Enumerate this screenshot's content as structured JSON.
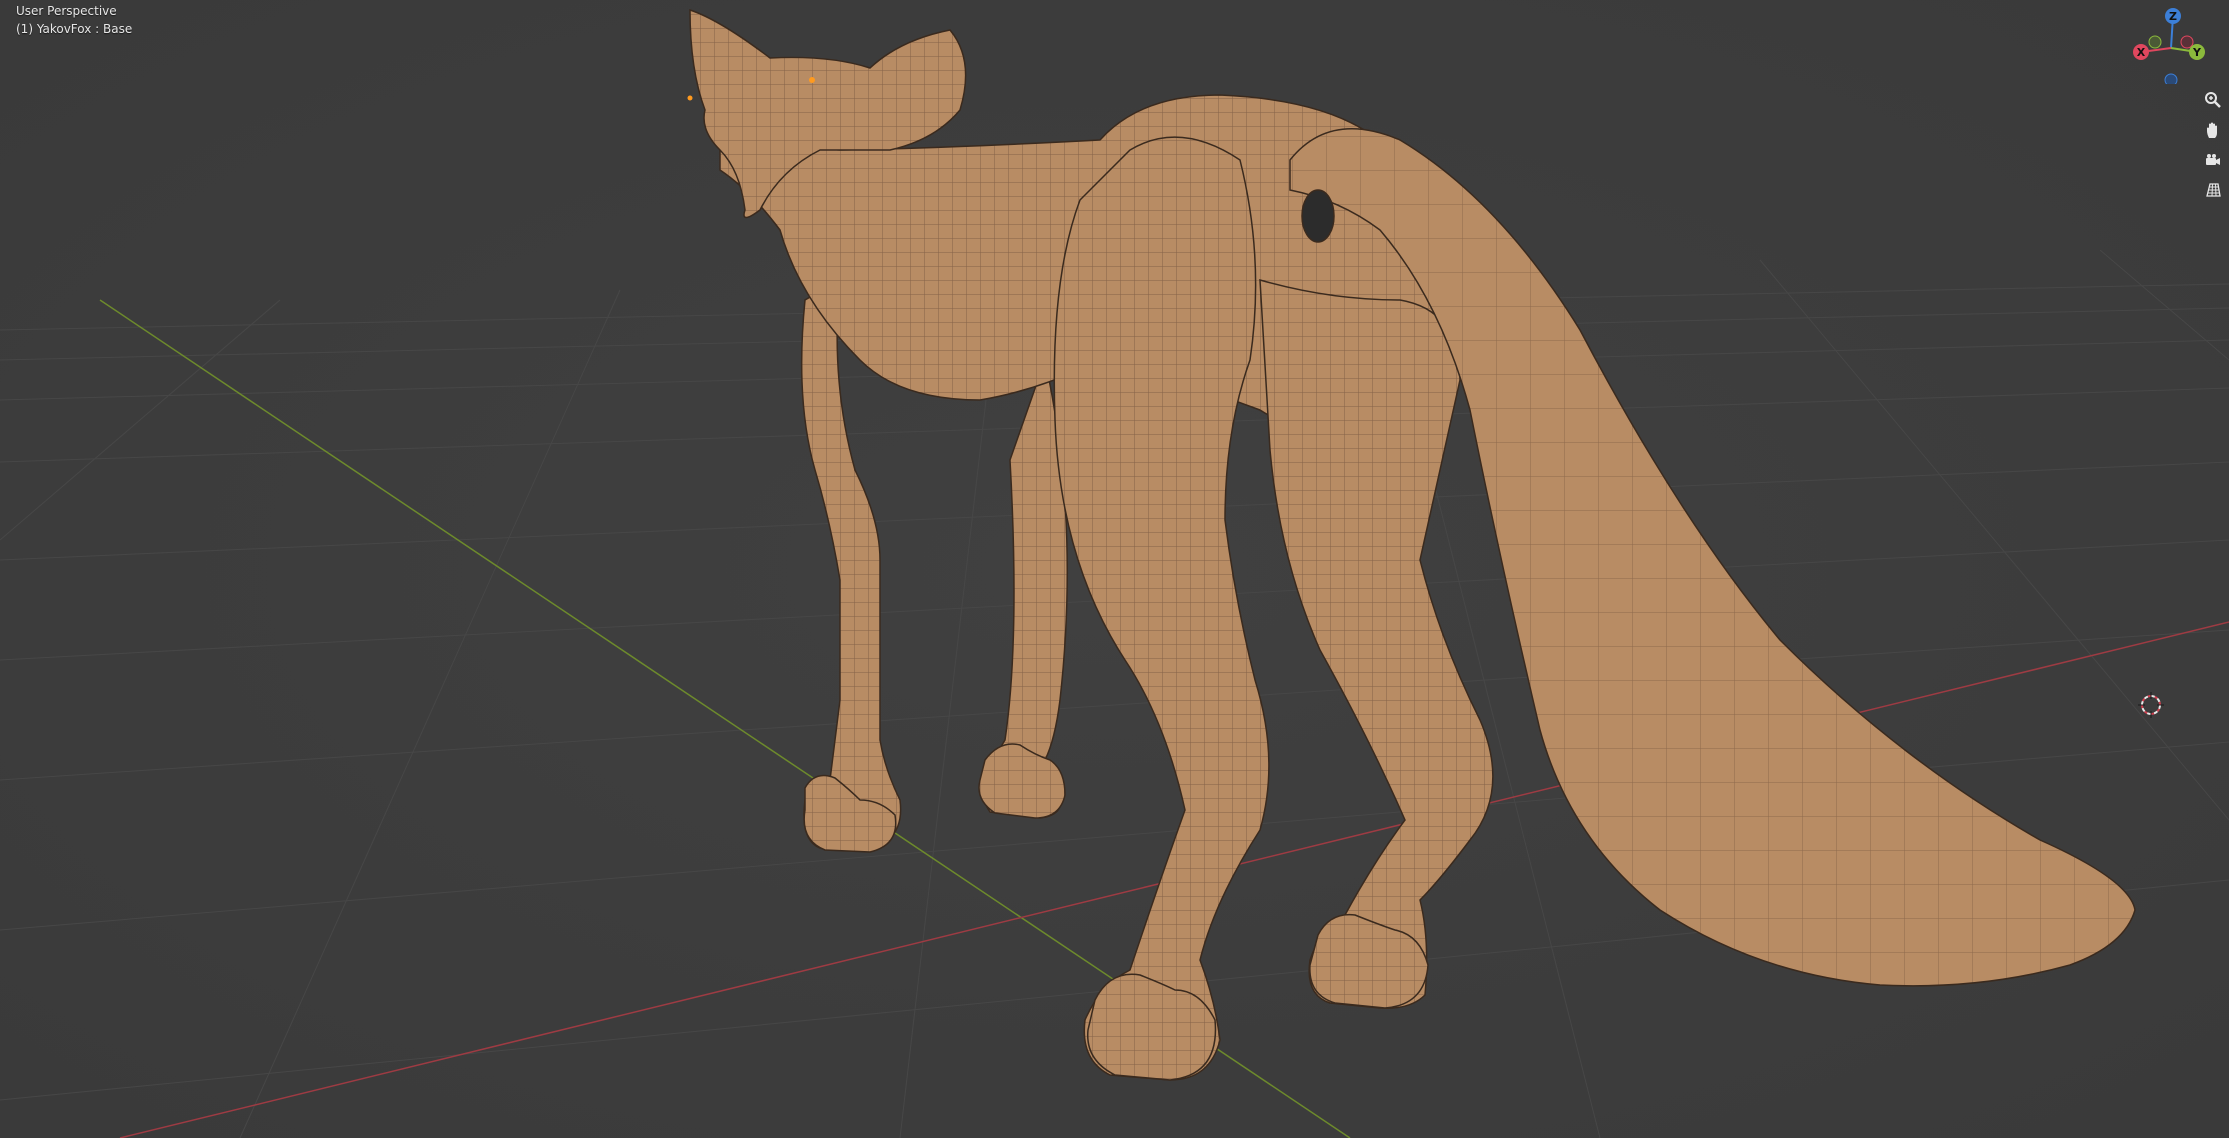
{
  "viewport": {
    "view_mode": "User Perspective",
    "object_info": "(1) YakovFox : Base"
  },
  "gizmo": {
    "z_label": "Z",
    "y_label": "Y",
    "x_label": "X",
    "colors": {
      "x": "#e0475e",
      "y": "#8bba3c",
      "z": "#3c7fd8",
      "background": "#3d3d3d",
      "mesh": "#b58a63",
      "grid": "#484848",
      "x_axis_line": "#9e3b43",
      "y_axis_line": "#6d8a2c"
    }
  },
  "nav_controls": {
    "zoom": "zoom-icon",
    "pan": "hand-icon",
    "camera": "camera-icon",
    "ortho": "grid-icon"
  }
}
